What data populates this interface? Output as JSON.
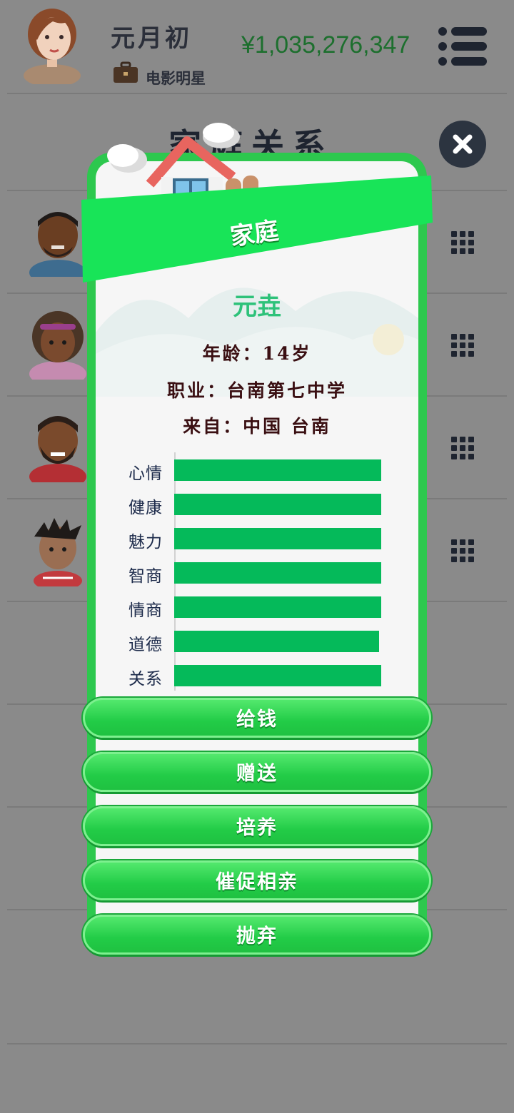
{
  "player": {
    "name": "元月初",
    "job": "电影明星",
    "money": "¥1,035,276,347"
  },
  "page": {
    "title": "家庭关系"
  },
  "modal": {
    "banner_title": "家庭",
    "person_name": "元垚",
    "age_line": "年龄：14岁",
    "job_line": "职业：台南第七中学",
    "from_line": "来自：中国 台南",
    "stats": [
      {
        "label": "心情",
        "value": 1.0
      },
      {
        "label": "健康",
        "value": 1.0
      },
      {
        "label": "魅力",
        "value": 1.0
      },
      {
        "label": "智商",
        "value": 1.0
      },
      {
        "label": "情商",
        "value": 1.0
      },
      {
        "label": "道德",
        "value": 0.99
      },
      {
        "label": "关系",
        "value": 1.0
      }
    ],
    "buttons": [
      "给钱",
      "赠送",
      "培养",
      "催促相亲",
      "抛弃"
    ]
  },
  "colors": {
    "accent": "#2dc84e",
    "stat_bar": "#05ba5a",
    "money": "#1d6f2e"
  }
}
